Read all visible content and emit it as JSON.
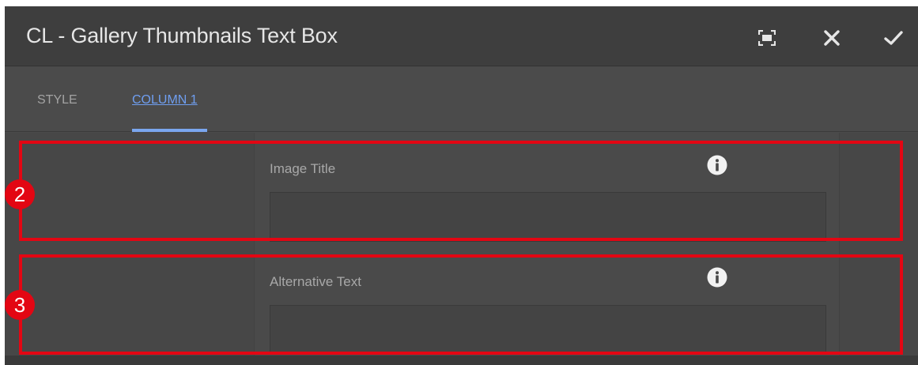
{
  "dialog": {
    "title": "CL - Gallery Thumbnails Text Box",
    "buttons": {
      "fullscreen_icon": "fullscreen-icon",
      "close_icon": "close-icon",
      "done_icon": "checkmark-icon"
    }
  },
  "tabs": [
    {
      "label": "STYLE",
      "active": false
    },
    {
      "label": "COLUMN 1",
      "active": true
    }
  ],
  "fields": [
    {
      "label": "Image Title",
      "value": "",
      "info_icon": "info-icon"
    },
    {
      "label": "Alternative Text",
      "value": "",
      "info_icon": "info-icon"
    }
  ],
  "callouts": [
    {
      "number": "2"
    },
    {
      "number": "3"
    }
  ],
  "colors": {
    "accent": "#6f9ef0",
    "callout": "#e30613",
    "dialog_bg": "#4a4a4a",
    "titlebar_bg": "#3e3e3e"
  }
}
